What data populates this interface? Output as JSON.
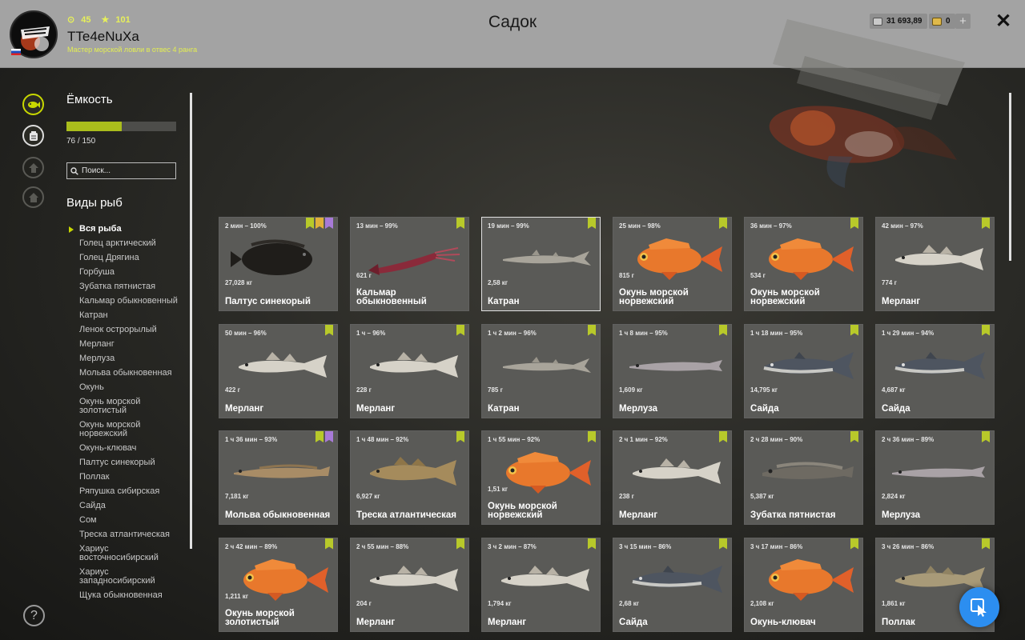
{
  "header": {
    "title": "Садок",
    "player": {
      "name": "TTe4eNuXa",
      "level_stat": "45",
      "star_stat": "101",
      "rank_text": "Мастер морской ловли в отвес 4 ранга"
    },
    "silver_amount": "31 693,89",
    "gold_amount": "0",
    "plus_label": "+",
    "close_label": "✕"
  },
  "sidebar": {
    "capacity_label": "Ёмкость",
    "capacity_used": 76,
    "capacity_max": 150,
    "capacity_text": "76 / 150",
    "search_placeholder": "Поиск...",
    "species_heading": "Виды рыб",
    "help_label": "?",
    "species": [
      {
        "label": "Вся рыба",
        "active": true
      },
      {
        "label": "Голец арктический"
      },
      {
        "label": "Голец Дрягина"
      },
      {
        "label": "Горбуша"
      },
      {
        "label": "Зубатка пятнистая"
      },
      {
        "label": "Кальмар обыкновенный"
      },
      {
        "label": "Катран"
      },
      {
        "label": "Ленок острорылый"
      },
      {
        "label": "Мерланг"
      },
      {
        "label": "Мерлуза"
      },
      {
        "label": "Мольва обыкновенная"
      },
      {
        "label": "Окунь"
      },
      {
        "label": "Окунь морской золотистый"
      },
      {
        "label": "Окунь морской норвежский"
      },
      {
        "label": "Окунь-клювач"
      },
      {
        "label": "Палтус синекорый"
      },
      {
        "label": "Поллак"
      },
      {
        "label": "Ряпушка сибирская"
      },
      {
        "label": "Сайда"
      },
      {
        "label": "Сом"
      },
      {
        "label": "Треска атлантическая"
      },
      {
        "label": "Хариус восточносибирский"
      },
      {
        "label": "Хариус западносибирский"
      },
      {
        "label": "Щука обыкновенная"
      }
    ]
  },
  "catch": [
    {
      "time": "2 мин – 100%",
      "weight": "27,028 кг",
      "name": "Палтус синекорый",
      "shape": "halibut",
      "badges": [
        "green",
        "gold",
        "purple"
      ]
    },
    {
      "time": "13 мин – 99%",
      "weight": "621 г",
      "name": "Кальмар обыкновенный",
      "shape": "squid",
      "badges": [
        "green"
      ]
    },
    {
      "time": "19 мин – 99%",
      "weight": "2,58 кг",
      "name": "Катран",
      "shape": "shark",
      "badges": [
        "green"
      ],
      "selected": true
    },
    {
      "time": "25 мин – 98%",
      "weight": "815 г",
      "name": "Окунь морской норвежский",
      "shape": "redperch",
      "badges": [
        "green"
      ]
    },
    {
      "time": "36 мин – 97%",
      "weight": "534 г",
      "name": "Окунь морской норвежский",
      "shape": "redperch",
      "badges": [
        "green"
      ]
    },
    {
      "time": "42 мин – 97%",
      "weight": "774 г",
      "name": "Мерланг",
      "shape": "cod",
      "badges": [
        "green"
      ]
    },
    {
      "time": "50 мин – 96%",
      "weight": "422 г",
      "name": "Мерланг",
      "shape": "cod",
      "badges": [
        "green"
      ]
    },
    {
      "time": "1 ч – 96%",
      "weight": "228 г",
      "name": "Мерланг",
      "shape": "cod",
      "badges": [
        "green"
      ]
    },
    {
      "time": "1 ч 2 мин – 96%",
      "weight": "785 г",
      "name": "Катран",
      "shape": "shark",
      "badges": [
        "green"
      ]
    },
    {
      "time": "1 ч 8 мин – 95%",
      "weight": "1,609 кг",
      "name": "Мерлуза",
      "shape": "hake",
      "badges": [
        "green"
      ]
    },
    {
      "time": "1 ч 18 мин – 95%",
      "weight": "14,795 кг",
      "name": "Сайда",
      "shape": "saithe",
      "badges": [
        "green"
      ]
    },
    {
      "time": "1 ч 29 мин – 94%",
      "weight": "4,687 кг",
      "name": "Сайда",
      "shape": "saithe",
      "badges": [
        "green"
      ]
    },
    {
      "time": "1 ч 36 мин – 93%",
      "weight": "7,181 кг",
      "name": "Мольва обыкновенная",
      "shape": "ling",
      "badges": [
        "green",
        "purple"
      ]
    },
    {
      "time": "1 ч 48 мин – 92%",
      "weight": "6,927 кг",
      "name": "Треска атлантическая",
      "shape": "atlcod",
      "badges": [
        "green"
      ]
    },
    {
      "time": "1 ч 55 мин – 92%",
      "weight": "1,51 кг",
      "name": "Окунь морской норвежский",
      "shape": "redperch",
      "badges": [
        "green"
      ]
    },
    {
      "time": "2 ч 1 мин – 92%",
      "weight": "238 г",
      "name": "Мерланг",
      "shape": "cod",
      "badges": [
        "green"
      ]
    },
    {
      "time": "2 ч 28 мин – 90%",
      "weight": "5,387 кг",
      "name": "Зубатка пятнистая",
      "shape": "wolffish",
      "badges": [
        "green"
      ]
    },
    {
      "time": "2 ч 36 мин – 89%",
      "weight": "2,824 кг",
      "name": "Мерлуза",
      "shape": "hake",
      "badges": [
        "green"
      ]
    },
    {
      "time": "2 ч 42 мин – 89%",
      "weight": "1,211 кг",
      "name": "Окунь морской золотистый",
      "shape": "redperch",
      "badges": [
        "green"
      ]
    },
    {
      "time": "2 ч 55 мин – 88%",
      "weight": "204 г",
      "name": "Мерланг",
      "shape": "cod",
      "badges": [
        "green"
      ]
    },
    {
      "time": "3 ч 2 мин – 87%",
      "weight": "1,794 кг",
      "name": "Мерланг",
      "shape": "cod",
      "badges": [
        "green"
      ]
    },
    {
      "time": "3 ч 15 мин – 86%",
      "weight": "2,68 кг",
      "name": "Сайда",
      "shape": "saithe",
      "badges": [
        "green"
      ]
    },
    {
      "time": "3 ч 17 мин – 86%",
      "weight": "2,108 кг",
      "name": "Окунь-клювач",
      "shape": "redperch",
      "badges": [
        "green"
      ]
    },
    {
      "time": "3 ч 26 мин – 86%",
      "weight": "1,861 кг",
      "name": "Поллак",
      "shape": "pollack",
      "badges": [
        "green"
      ]
    }
  ]
}
